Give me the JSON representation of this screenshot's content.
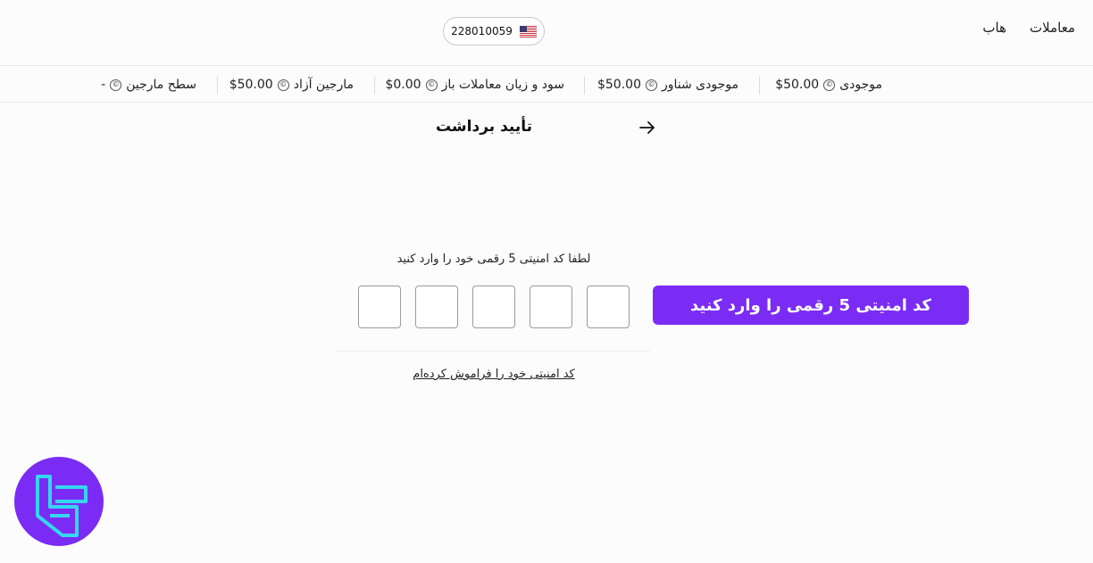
{
  "header": {
    "nav": [
      {
        "label": "معاملات"
      },
      {
        "label": "هاب"
      }
    ],
    "account_number": "228010059",
    "flag_icon": "us-flag-icon"
  },
  "stats": [
    {
      "label": "موجودی",
      "value": "$50.00"
    },
    {
      "label": "موجودی شناور",
      "value": "$50.00"
    },
    {
      "label": "سود و زیان معاملات باز",
      "value": "$0.00"
    },
    {
      "label": "مارجین آزاد",
      "value": "$50.00"
    },
    {
      "label": "سطح مارجین",
      "value": "-"
    }
  ],
  "page": {
    "title": "تأیید برداشت",
    "back_icon": "arrow-right-icon"
  },
  "pin": {
    "prompt": "لطفا کد امنیتی 5 رقمی خود را وارد کنید",
    "digit_count": 5,
    "submit_label": "کد امنیتی 5 رقمی را وارد کنید",
    "forgot_label": "کد امنیتی خود را فراموش کرده‌ام"
  },
  "colors": {
    "accent": "#7a2cf5",
    "logo_bg": "#7a2cf5",
    "logo_stroke": "#35d6f0"
  }
}
